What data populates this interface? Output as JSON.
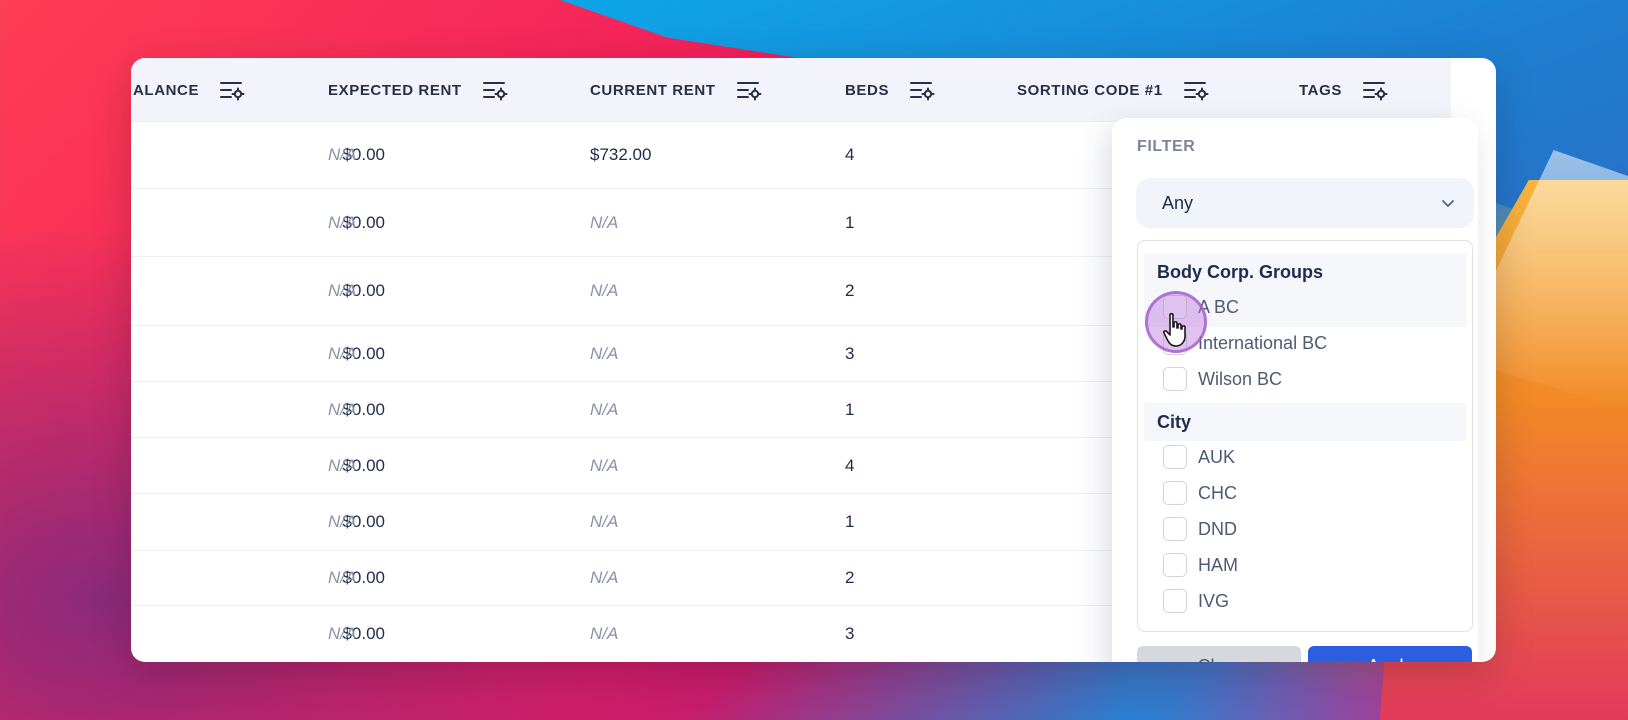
{
  "table": {
    "headers": [
      {
        "label": "ALANCE"
      },
      {
        "label": "EXPECTED RENT"
      },
      {
        "label": "CURRENT RENT"
      },
      {
        "label": "BEDS"
      },
      {
        "label": "SORTING CODE #1"
      },
      {
        "label": "TAGS"
      }
    ],
    "rows": [
      {
        "balance": "$0.00",
        "expected_rent": "N/A",
        "current_rent": "$732.00",
        "beds": "4"
      },
      {
        "balance": "$0.00",
        "expected_rent": "N/A",
        "current_rent": "N/A",
        "beds": "1"
      },
      {
        "balance": "$0.00",
        "expected_rent": "N/A",
        "current_rent": "N/A",
        "beds": "2"
      },
      {
        "balance": "$0.00",
        "expected_rent": "N/A",
        "current_rent": "N/A",
        "beds": "3"
      },
      {
        "balance": "$0.00",
        "expected_rent": "N/A",
        "current_rent": "N/A",
        "beds": "1"
      },
      {
        "balance": "$0.00",
        "expected_rent": "N/A",
        "current_rent": "N/A",
        "beds": "4"
      },
      {
        "balance": "$0.00",
        "expected_rent": "N/A",
        "current_rent": "N/A",
        "beds": "1"
      },
      {
        "balance": "$0.00",
        "expected_rent": "N/A",
        "current_rent": "N/A",
        "beds": "2"
      },
      {
        "balance": "$0.00",
        "expected_rent": "N/A",
        "current_rent": "N/A",
        "beds": "3"
      }
    ]
  },
  "filter": {
    "title": "FILTER",
    "select_value": "Any",
    "groups": [
      {
        "label": "Body Corp. Groups",
        "options": [
          "A BC",
          "International BC",
          "Wilson BC"
        ]
      },
      {
        "label": "City",
        "options": [
          "AUK",
          "CHC",
          "DND",
          "HAM",
          "IVG"
        ]
      }
    ],
    "clear_label": "Clear",
    "apply_label": "Apply"
  },
  "icons": {
    "column_settings": "column-settings-icon",
    "dropdown": "chevron-down-icon",
    "cursor": "hand-pointer-icon"
  },
  "colors": {
    "accent": "#2b5fe0",
    "header_bg": "#f3f4fb",
    "text_dark": "#1f2b4d",
    "text_muted": "#8a93a8"
  }
}
